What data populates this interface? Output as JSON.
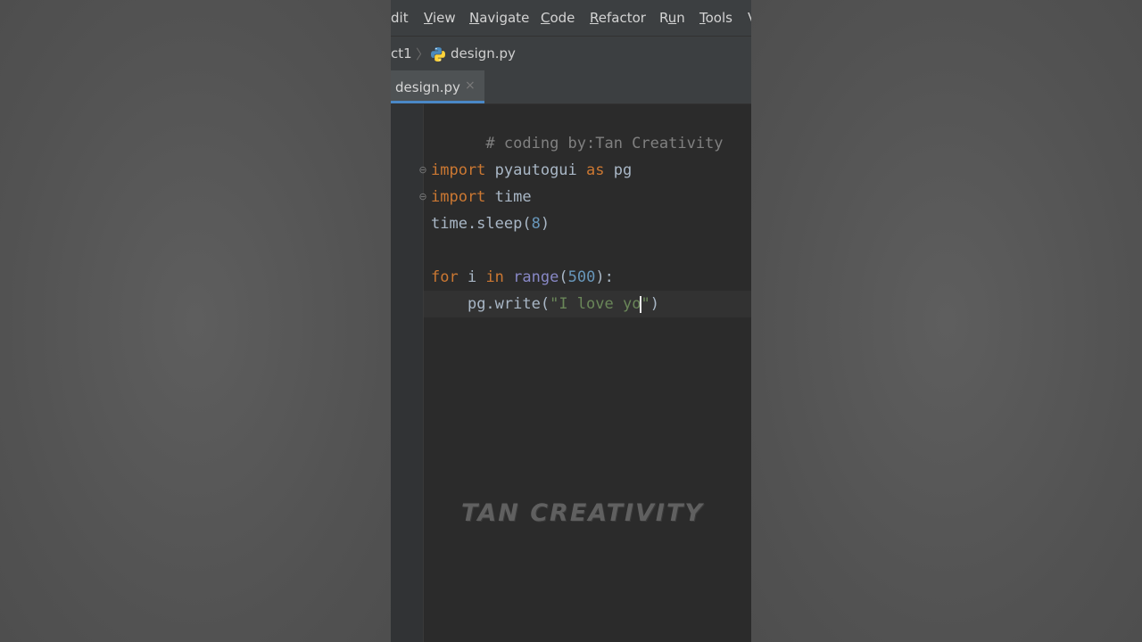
{
  "menubar": {
    "items": [
      {
        "label_pre": "",
        "mnemonic": "",
        "label_post": "dit"
      },
      {
        "label_pre": "",
        "mnemonic": "V",
        "label_post": "iew"
      },
      {
        "label_pre": "",
        "mnemonic": "N",
        "label_post": "avigate"
      },
      {
        "label_pre": "",
        "mnemonic": "C",
        "label_post": "ode"
      },
      {
        "label_pre": "",
        "mnemonic": "R",
        "label_post": "efactor"
      },
      {
        "label_pre": "R",
        "mnemonic": "u",
        "label_post": "n"
      },
      {
        "label_pre": "",
        "mnemonic": "T",
        "label_post": "ools"
      },
      {
        "label_pre": "",
        "mnemonic": "",
        "label_post": "V"
      }
    ]
  },
  "navbar": {
    "project": "ct1",
    "separator": "〉",
    "file": "design.py"
  },
  "tabs": {
    "active_label": "design.py",
    "close_glyph": "×"
  },
  "editor": {
    "line1": "# coding by:Tan Creativity",
    "line3": {
      "kw1": "import",
      "mod": " pyautogui ",
      "kw2": "as",
      "alias": " pg"
    },
    "line4": {
      "kw": "import",
      "mod": " time"
    },
    "line5": {
      "pre": "time.sleep(",
      "num": "8",
      "post": ")"
    },
    "line7": {
      "kw1": "for",
      "var": " i ",
      "kw2": "in",
      "sp": " ",
      "fn": "range",
      "open": "(",
      "num": "500",
      "close": "):"
    },
    "line8": {
      "indent": "    ",
      "call": "pg.write(",
      "str_before_cursor": "\"I love yo",
      "str_after_cursor": "\"",
      "close": ")"
    }
  },
  "watermark": "TAN CREATIVITY",
  "colors": {
    "keyword": "#cc7832",
    "comment": "#808080",
    "number": "#6897bb",
    "string": "#6a8759",
    "builtin": "#8888c6",
    "tab_accent": "#4a88c7"
  }
}
